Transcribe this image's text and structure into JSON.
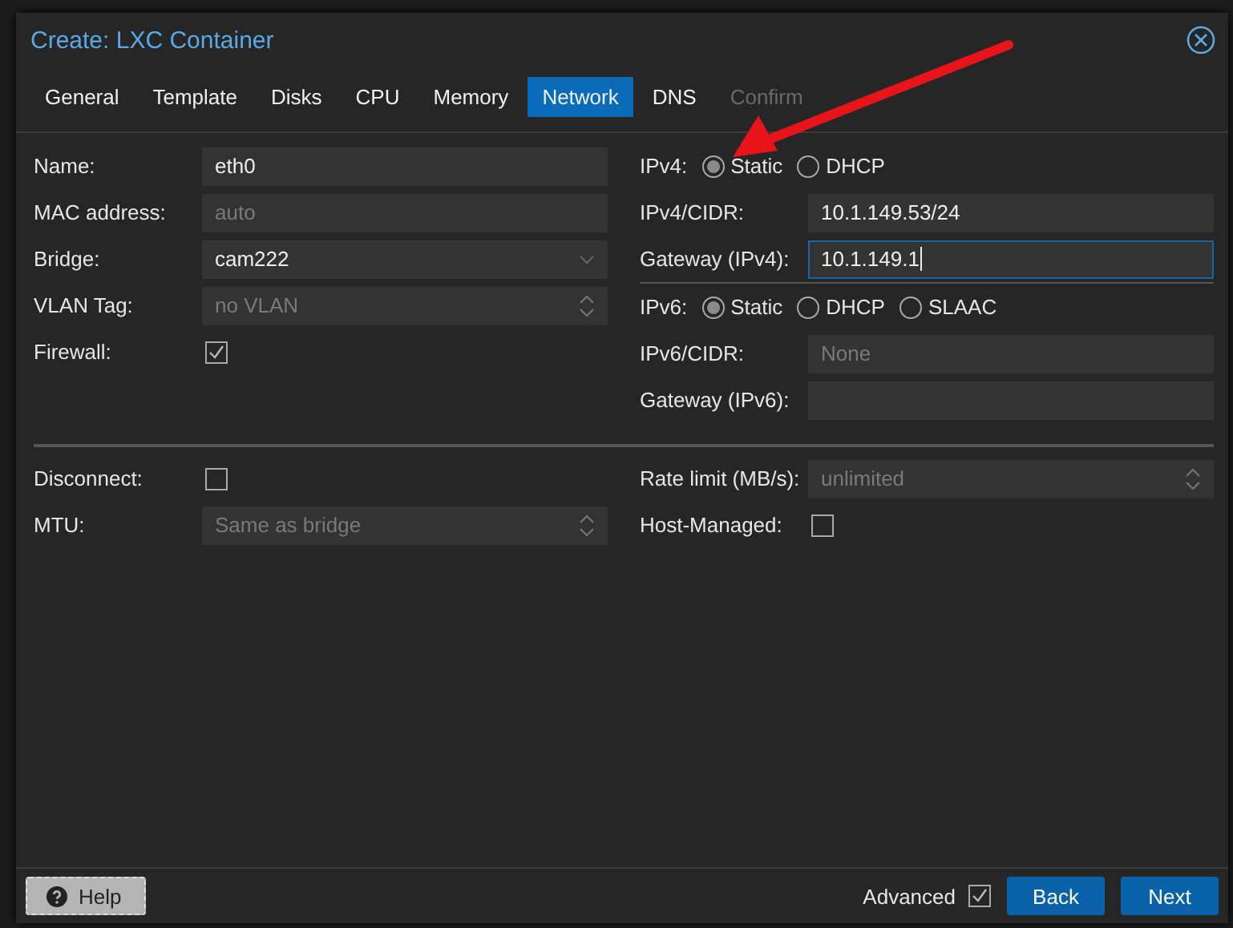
{
  "window": {
    "title": "Create: LXC Container"
  },
  "tabs": [
    {
      "label": "General",
      "selected": false,
      "disabled": false
    },
    {
      "label": "Template",
      "selected": false,
      "disabled": false
    },
    {
      "label": "Disks",
      "selected": false,
      "disabled": false
    },
    {
      "label": "CPU",
      "selected": false,
      "disabled": false
    },
    {
      "label": "Memory",
      "selected": false,
      "disabled": false
    },
    {
      "label": "Network",
      "selected": true,
      "disabled": false
    },
    {
      "label": "DNS",
      "selected": false,
      "disabled": false
    },
    {
      "label": "Confirm",
      "selected": false,
      "disabled": true
    }
  ],
  "left_fields": [
    {
      "kind": "text",
      "label": "Name:",
      "value": "eth0"
    },
    {
      "kind": "text",
      "label": "MAC address:",
      "placeholder": "auto"
    },
    {
      "kind": "combo",
      "label": "Bridge:",
      "value": "cam222"
    },
    {
      "kind": "spinner",
      "label": "VLAN Tag:",
      "placeholder": "no VLAN"
    },
    {
      "kind": "checkbox",
      "label": "Firewall:",
      "checked": true
    }
  ],
  "right_fields": [
    {
      "kind": "radio",
      "label": "IPv4:",
      "options": [
        {
          "label": "Static",
          "selected": true
        },
        {
          "label": "DHCP",
          "selected": false
        }
      ]
    },
    {
      "kind": "text",
      "label": "IPv4/CIDR:",
      "value": "10.1.149.53/24"
    },
    {
      "kind": "text",
      "label": "Gateway (IPv4):",
      "value": "10.1.149.1",
      "focused": true
    },
    {
      "kind": "separator"
    },
    {
      "kind": "radio",
      "label": "IPv6:",
      "options": [
        {
          "label": "Static",
          "selected": true
        },
        {
          "label": "DHCP",
          "selected": false
        },
        {
          "label": "SLAAC",
          "selected": false
        }
      ]
    },
    {
      "kind": "text",
      "label": "IPv6/CIDR:",
      "placeholder": "None"
    },
    {
      "kind": "text",
      "label": "Gateway (IPv6):"
    }
  ],
  "advanced_left": [
    {
      "kind": "checkbox",
      "label": "Disconnect:",
      "checked": false
    },
    {
      "kind": "spinner",
      "label": "MTU:",
      "placeholder": "Same as bridge"
    }
  ],
  "advanced_right": [
    {
      "kind": "spinner",
      "label": "Rate limit (MB/s):",
      "placeholder": "unlimited"
    },
    {
      "kind": "checkbox",
      "label": "Host-Managed:",
      "checked": false
    }
  ],
  "footer": {
    "help": "Help",
    "advanced": {
      "label": "Advanced",
      "checked": true
    },
    "buttons": [
      "Back",
      "Next"
    ]
  }
}
